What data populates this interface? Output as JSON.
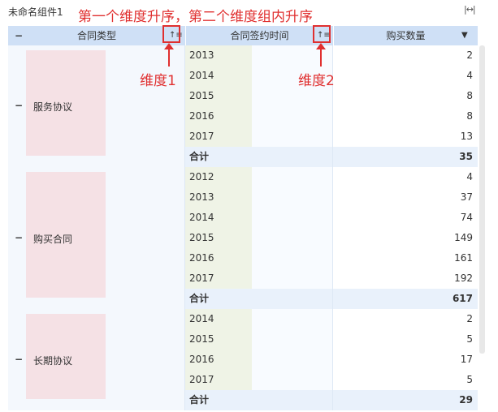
{
  "widget": {
    "title": "未命名组件1",
    "expand_icon": "|↔|"
  },
  "annotations": {
    "top": "第一个维度升序，第二个维度组内升序",
    "dim1": "维度1",
    "dim2": "维度2"
  },
  "header": {
    "collapse_all": "−",
    "col1": "合同类型",
    "col2": "合同签约时间",
    "col3": "购买数量",
    "sort_glyph": "↑≡",
    "dropdown_glyph": "▼"
  },
  "colors": {
    "header_bg": "#cfe0f6",
    "annotation_red": "#e03030",
    "total_bg": "#e9f1fb"
  },
  "groups": [
    {
      "name": "服务协议",
      "toggle": "−",
      "rows": [
        {
          "year": "2013",
          "qty": "2"
        },
        {
          "year": "2014",
          "qty": "4"
        },
        {
          "year": "2015",
          "qty": "8"
        },
        {
          "year": "2016",
          "qty": "8"
        },
        {
          "year": "2017",
          "qty": "13"
        }
      ],
      "total_label": "合计",
      "total": "35"
    },
    {
      "name": "购买合同",
      "toggle": "−",
      "rows": [
        {
          "year": "2012",
          "qty": "4"
        },
        {
          "year": "2013",
          "qty": "37"
        },
        {
          "year": "2014",
          "qty": "74"
        },
        {
          "year": "2015",
          "qty": "149"
        },
        {
          "year": "2016",
          "qty": "161"
        },
        {
          "year": "2017",
          "qty": "192"
        }
      ],
      "total_label": "合计",
      "total": "617"
    },
    {
      "name": "长期协议",
      "toggle": "−",
      "rows": [
        {
          "year": "2014",
          "qty": "2"
        },
        {
          "year": "2015",
          "qty": "5"
        },
        {
          "year": "2016",
          "qty": "17"
        },
        {
          "year": "2017",
          "qty": "5"
        }
      ],
      "total_label": "合计",
      "total": "29"
    }
  ]
}
